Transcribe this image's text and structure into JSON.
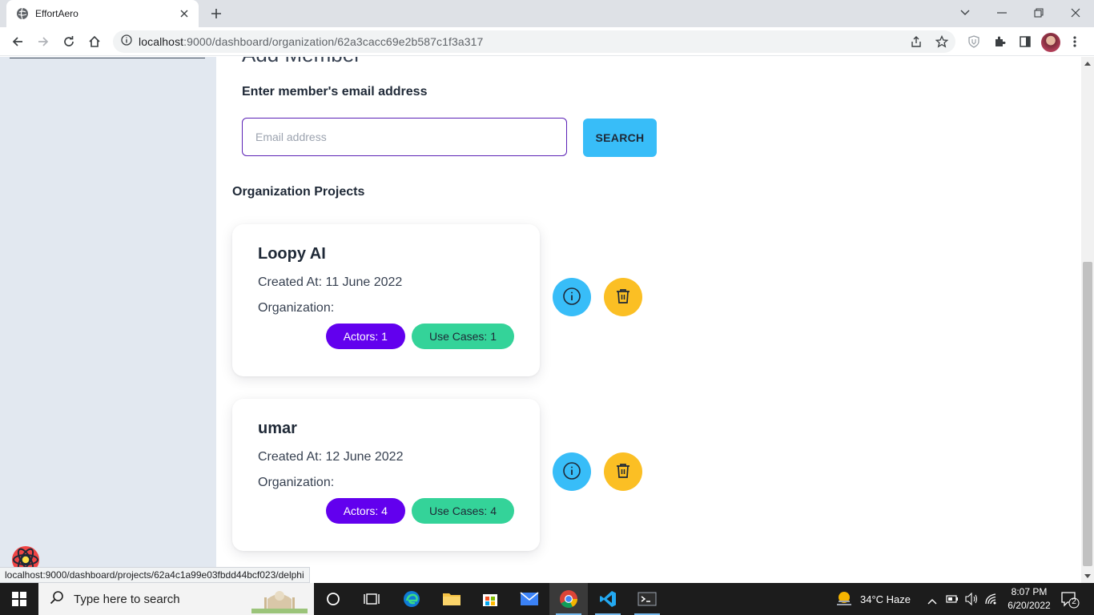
{
  "browser": {
    "tab_title": "EffortAero",
    "url_host": "localhost",
    "url_rest": ":9000/dashboard/organization/62a3cacc69e2b587c1f3a317"
  },
  "page": {
    "heading": "Add Member",
    "email_label": "Enter member's email address",
    "email_placeholder": "Email address",
    "email_value": "",
    "search_label": "SEARCH",
    "projects_title": "Organization Projects",
    "projects": [
      {
        "name": "Loopy AI",
        "created": "Created At: 11 June 2022",
        "organization": "Organization:",
        "actors": "Actors: 1",
        "use_cases": "Use Cases: 1"
      },
      {
        "name": "umar",
        "created": "Created At: 12 June 2022",
        "organization": "Organization:",
        "actors": "Actors: 4",
        "use_cases": "Use Cases: 4"
      }
    ]
  },
  "status_bar": {
    "hover_url": "localhost:9000/dashboard/projects/62a4c1a99e03fbdd44bcf023/delphi"
  },
  "taskbar": {
    "search_placeholder": "Type here to search",
    "weather": "34°C  Haze",
    "time": "8:07 PM",
    "date": "6/20/2022",
    "notification_count": "2"
  },
  "colors": {
    "primary_purple": "#6200ee",
    "accent_cyan": "#38bdf8",
    "accent_green": "#34d399",
    "accent_amber": "#fbbf24",
    "sidebar_bg": "#e2e8f0"
  },
  "icons": [
    "chrome-favicon",
    "info-icon",
    "trash-icon",
    "react-icon",
    "windows-start-icon"
  ]
}
